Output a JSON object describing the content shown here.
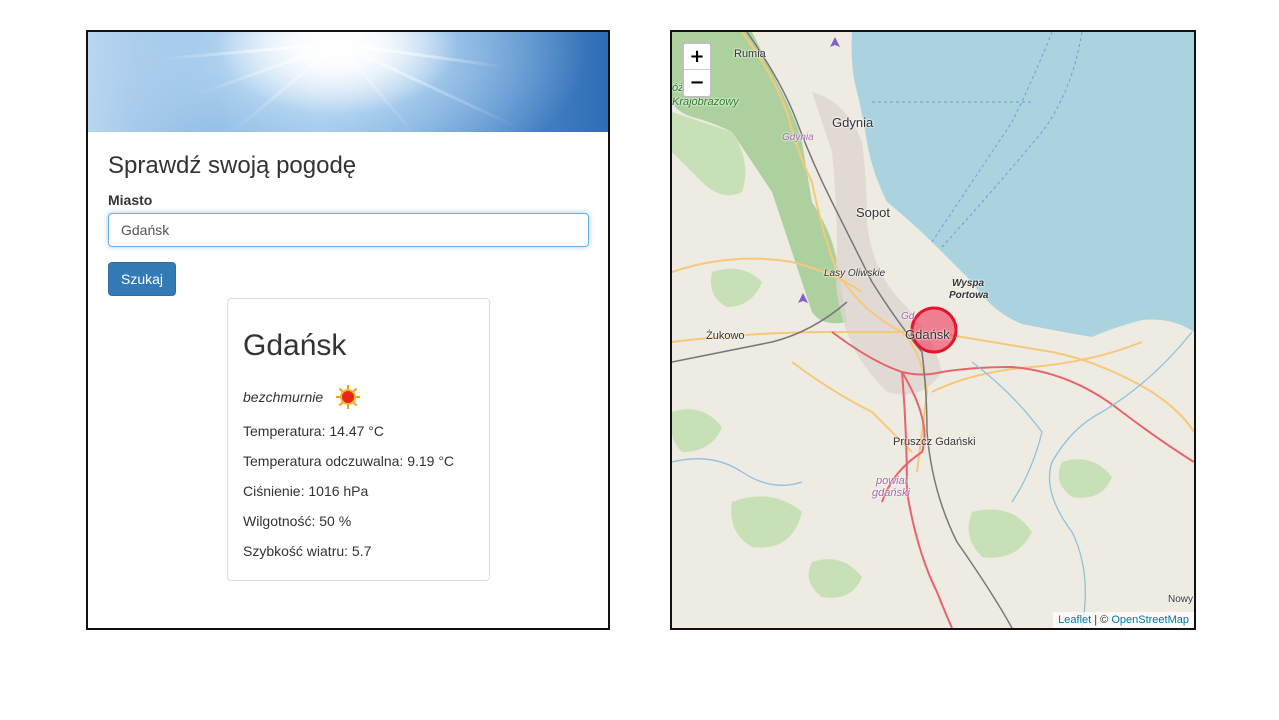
{
  "form": {
    "title": "Sprawdź swoją pogodę",
    "city_label": "Miasto",
    "city_value": "Gdańsk",
    "search_button": "Szukaj"
  },
  "weather": {
    "city": "Gdańsk",
    "description": "bezchmurnie",
    "temperature": "Temperatura: 14.47 °C",
    "feels_like": "Temperatura odczuwalna: 9.19 °C",
    "pressure": "Ciśnienie: 1016 hPa",
    "humidity": "Wilgotność: 50 %",
    "wind": "Szybkość wiatru: 5.7"
  },
  "map": {
    "zoom_in": "+",
    "zoom_out": "−",
    "attribution": {
      "leaflet": "Leaflet",
      "sep": " | © ",
      "osm": "OpenStreetMap"
    },
    "labels": {
      "rumia": "Rumia",
      "park": "óżski",
      "krajobrazowy": "Krajobrazowy",
      "gdynia": "Gdynia",
      "gdynia_small": "Gdynia",
      "sopot": "Sopot",
      "lasy": "Lasy Oliwskie",
      "wyspa": "Wyspa",
      "portowa": "Portowa",
      "gdansk": "Gdańsk",
      "gdansk_small": "Gd",
      "zukowo": "Żukowo",
      "pruszcz": "Pruszcz Gdański",
      "powiat": "powiat",
      "gdanski": "gdański",
      "nowy": "Nowy"
    }
  }
}
